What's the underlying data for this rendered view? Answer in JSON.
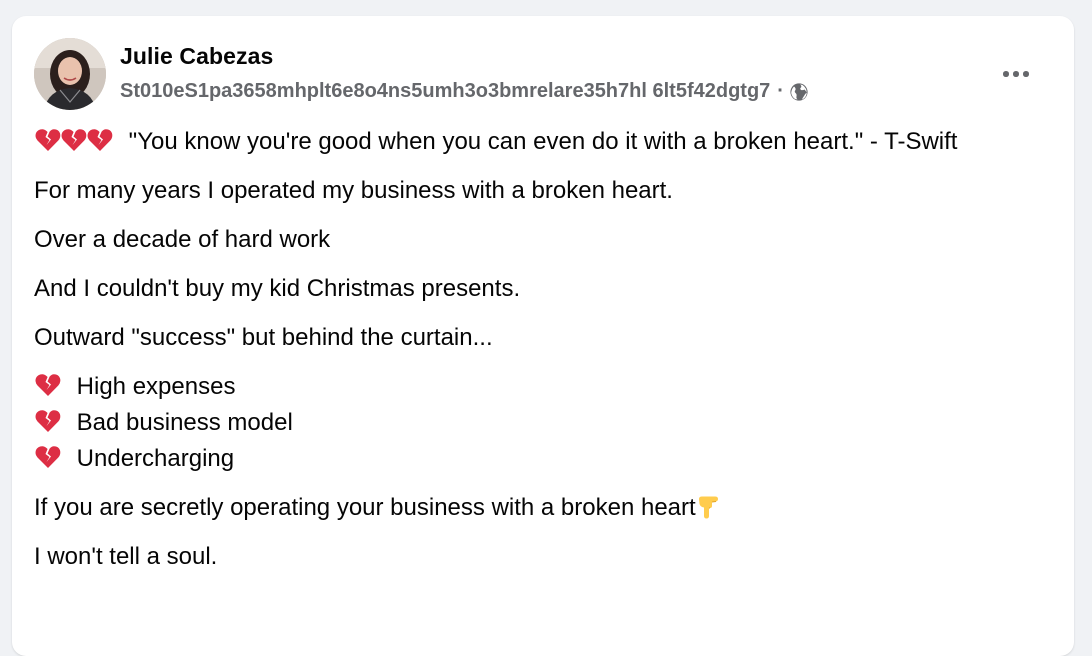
{
  "post": {
    "author": "Julie Cabezas",
    "meta_text": "St010eS1pa3658mhplt6e8o4ns5umh3o3bmrelare35h7hl 6lt5f42dgtg7",
    "meta_separator": "·",
    "audience_icon": "globe-icon",
    "more_icon": "more-options-icon",
    "quote_line": "\"You know you're good when you can even do it with a broken heart.\" - T-Swift",
    "paragraphs": [
      "For many years I operated my business with a broken heart.",
      "Over a decade of hard work",
      "And I couldn't buy my kid Christmas presents.",
      "Outward \"success\" but behind the curtain..."
    ],
    "list_items": [
      "High expenses",
      "Bad business model",
      "Undercharging"
    ],
    "closing_line": "If you are secretly operating your business with a broken heart",
    "final_line": "I won't tell a soul.",
    "emoji": {
      "broken_heart": "broken-heart-icon",
      "pointing_down": "backhand-index-pointing-down-icon"
    }
  },
  "colors": {
    "page_bg": "#f0f2f5",
    "card_bg": "#ffffff",
    "primary_text": "#050505",
    "secondary_text": "#65676b",
    "heart_red": "#dd2e44"
  }
}
